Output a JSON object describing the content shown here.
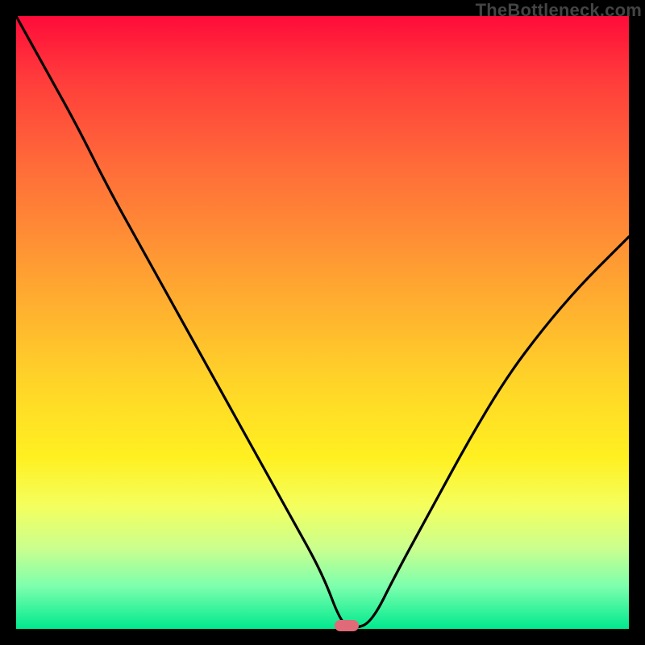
{
  "watermark": "TheBottleneck.com",
  "colors": {
    "frame": "#000000",
    "curve_stroke": "#000000",
    "marker_fill": "#e06a77"
  },
  "chart_data": {
    "type": "line",
    "title": "",
    "xlabel": "",
    "ylabel": "",
    "xlim": [
      0,
      100
    ],
    "ylim": [
      0,
      100
    ],
    "grid": false,
    "legend": false,
    "annotations": [
      {
        "kind": "pill_marker",
        "x": 54,
        "y": 0.5
      }
    ],
    "series": [
      {
        "name": "bottleneck-curve",
        "x": [
          0,
          5,
          10,
          15,
          20,
          25,
          30,
          35,
          40,
          45,
          50,
          53,
          55,
          58,
          62,
          68,
          74,
          80,
          86,
          92,
          98,
          100
        ],
        "values": [
          100,
          91,
          82,
          72,
          63,
          54,
          45,
          36,
          27,
          18,
          9,
          1,
          0,
          1,
          9,
          20,
          31,
          41,
          49,
          56,
          62,
          64
        ]
      }
    ]
  }
}
